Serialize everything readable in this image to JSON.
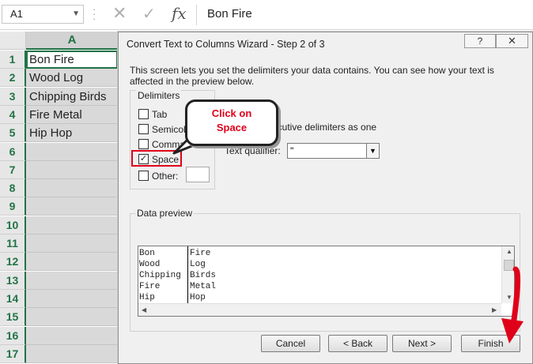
{
  "formula_bar": {
    "name_box": "A1",
    "content": "Bon Fire",
    "cancel_icon": "x-icon",
    "enter_icon": "check-icon",
    "fx_label": "fx"
  },
  "sheet": {
    "column_header": "A",
    "rows": [
      {
        "num": "1",
        "value": "Bon Fire"
      },
      {
        "num": "2",
        "value": "Wood Log"
      },
      {
        "num": "3",
        "value": "Chipping Birds"
      },
      {
        "num": "4",
        "value": "Fire Metal"
      },
      {
        "num": "5",
        "value": "Hip Hop"
      },
      {
        "num": "6",
        "value": ""
      },
      {
        "num": "7",
        "value": ""
      },
      {
        "num": "8",
        "value": ""
      },
      {
        "num": "9",
        "value": ""
      },
      {
        "num": "10",
        "value": ""
      },
      {
        "num": "11",
        "value": ""
      },
      {
        "num": "12",
        "value": ""
      },
      {
        "num": "13",
        "value": ""
      },
      {
        "num": "14",
        "value": ""
      },
      {
        "num": "15",
        "value": ""
      },
      {
        "num": "16",
        "value": ""
      },
      {
        "num": "17",
        "value": ""
      }
    ]
  },
  "dialog": {
    "title": "Convert Text to Columns Wizard - Step 2 of 3",
    "help_label": "?",
    "close_label": "✕",
    "description": "This screen lets you set the delimiters your data contains.  You can see how your text is affected in the preview below.",
    "delimiters_legend": "Delimiters",
    "delimiters": [
      {
        "label": "Tab",
        "checked": false
      },
      {
        "label": "Semicolon",
        "checked": false
      },
      {
        "label": "Comma",
        "checked": false
      },
      {
        "label": "Space",
        "checked": true
      },
      {
        "label": "Other:",
        "checked": false
      }
    ],
    "consecutive_label": "ecutive delimiters as one",
    "text_qualifier_label": "Text qualifier:",
    "text_qualifier_value": "\"",
    "data_preview_legend": "Data preview",
    "preview_rows": [
      [
        "Bon",
        "Fire"
      ],
      [
        "Wood",
        "Log"
      ],
      [
        "Chipping",
        "Birds"
      ],
      [
        "Fire",
        "Metal"
      ],
      [
        "Hip",
        "Hop"
      ]
    ],
    "buttons": {
      "cancel": "Cancel",
      "back": "< Back",
      "next": "Next >",
      "finish": "Finish"
    }
  },
  "callout": {
    "line1": "Click on",
    "line2": "Space"
  },
  "colors": {
    "excel_green": "#217346",
    "annotation_red": "#e0001a"
  }
}
